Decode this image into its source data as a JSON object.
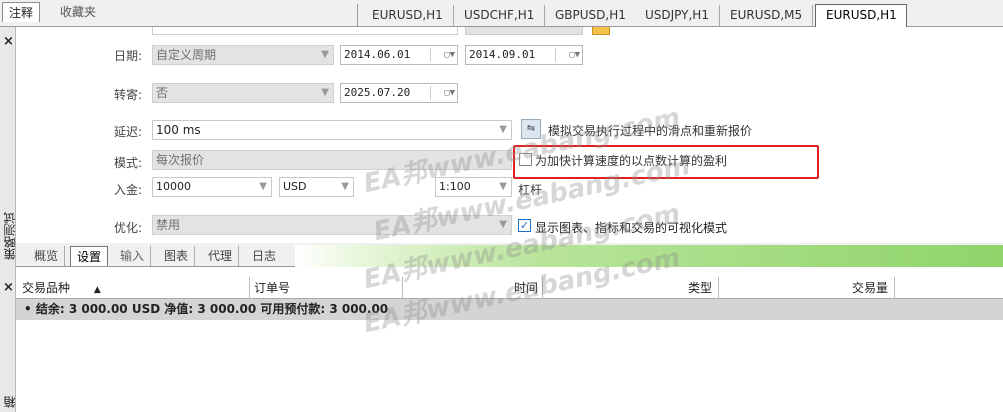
{
  "top_tabs": [
    "注释",
    "收藏夹"
  ],
  "chart_tabs": [
    "EURUSD,H1",
    "USDCHF,H1",
    "GBPUSD,H1",
    "USDJPY,H1",
    "EURUSD,M5",
    "EURUSD,H1"
  ],
  "strip": {
    "close": "×",
    "title": "策略测试",
    "title2": "箱"
  },
  "form": {
    "date_label": "日期:",
    "date_mode": "自定义周期",
    "date_from": "2014.06.01",
    "date_to": "2014.09.01",
    "forward_label": "转寄:",
    "forward_value": "否",
    "forward_date": "2025.07.20",
    "delay_label": "延迟:",
    "delay_value": "100 ms",
    "sim_label": "模拟交易执行过程中的滑点和重新报价",
    "model_label": "模式:",
    "model_value": "每次报价",
    "profit_cb_label": "为加快计算速度的以点数计算的盈利",
    "deposit_label": "入金:",
    "deposit_value": "10000",
    "currency": "USD",
    "leverage_value": "1:100",
    "leverage_label": "杠杆",
    "optimize_label": "优化:",
    "optimize_value": "禁用",
    "visual_cb_label": "显示图表、指标和交易的可视化模式"
  },
  "bottom_tabs": [
    "概览",
    "设置",
    "输入",
    "图表",
    "代理",
    "日志"
  ],
  "table": {
    "columns": [
      "交易品种",
      "订单号",
      "时间",
      "类型",
      "交易量"
    ],
    "sort_icon": "▲",
    "summary": "• 结余: 3 000.00 USD  净值: 3 000.00  可用预付款: 3 000.00"
  },
  "watermark": [
    "EA邦www.eabang.com",
    "EA邦www.eabang.com",
    "EA邦www.eabang.com",
    "EA邦www.eabang.com"
  ]
}
